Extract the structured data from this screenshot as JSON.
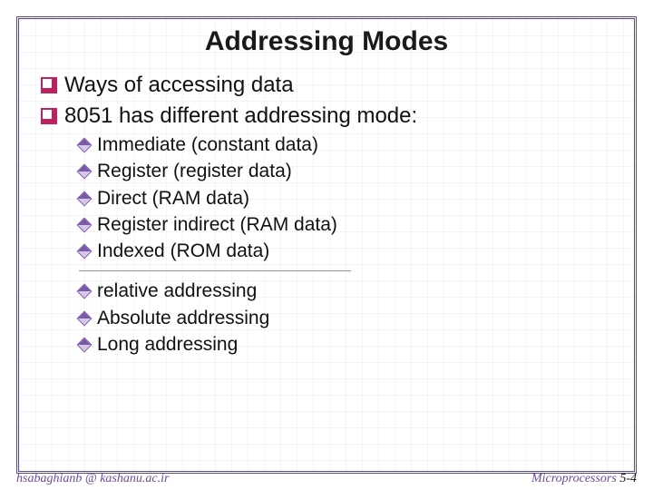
{
  "title": "Addressing Modes",
  "bullets": {
    "a": "Ways of accessing data",
    "b": "8051 has different addressing mode:"
  },
  "sub1": {
    "a": "Immediate (constant data)",
    "b": "Register (register data)",
    "c": "Direct (RAM data)",
    "d": "Register indirect (RAM data)",
    "e": "Indexed (ROM data)"
  },
  "sub2": {
    "a": "relative addressing",
    "b": "Absolute addressing",
    "c": "Long addressing"
  },
  "footer": {
    "left": "hsabaghianb @ kashanu.ac.ir",
    "right_label": "Microprocessors ",
    "right_page": "5-4"
  }
}
